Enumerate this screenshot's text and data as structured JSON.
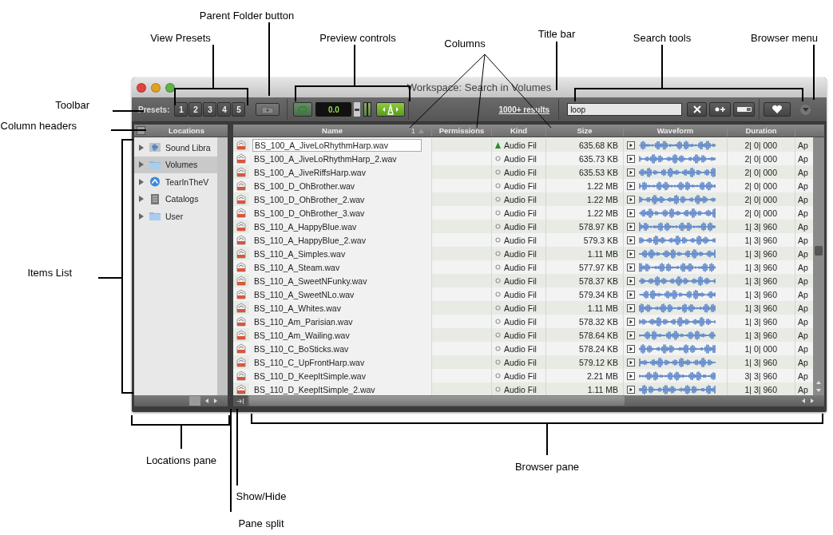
{
  "window": {
    "title": "Workspace: Search in Volumes"
  },
  "toolbar": {
    "presets_label": "Presets:",
    "presets": [
      "1",
      "2",
      "3",
      "4",
      "5"
    ],
    "counter": "0.0",
    "results": "1000+ results",
    "search": {
      "value": "loop"
    }
  },
  "locations": {
    "header": "Locations",
    "items": [
      {
        "label": "Sound Libra",
        "kind": "library",
        "selected": false,
        "expanded": false
      },
      {
        "label": "Volumes",
        "kind": "folder",
        "selected": true,
        "expanded": false
      },
      {
        "label": "TearInTheV",
        "kind": "disk",
        "selected": false,
        "expanded": false
      },
      {
        "label": "Catalogs",
        "kind": "catalog",
        "selected": false,
        "expanded": false
      },
      {
        "label": "User",
        "kind": "folder",
        "selected": false,
        "expanded": false
      }
    ]
  },
  "browser": {
    "columns": [
      {
        "label": "Name",
        "sort_index": "1"
      },
      {
        "label": "Permissions"
      },
      {
        "label": "Kind"
      },
      {
        "label": "Size"
      },
      {
        "label": "Waveform"
      },
      {
        "label": "Duration"
      }
    ],
    "rows": [
      {
        "name": "BS_100_A_JiveLoRhythmHarp.wav",
        "editing": true,
        "kind": "Audio Fil",
        "marked": true,
        "size": "635.68 KB",
        "duration": "2| 0| 000",
        "column_7": "Ap"
      },
      {
        "name": "BS_100_A_JiveLoRhythmHarp_2.wav",
        "editing": false,
        "kind": "Audio Fil",
        "marked": false,
        "size": "635.73 KB",
        "duration": "2| 0| 000",
        "column_7": "Ap"
      },
      {
        "name": "BS_100_A_JiveRiffsHarp.wav",
        "editing": false,
        "kind": "Audio Fil",
        "marked": false,
        "size": "635.53 KB",
        "duration": "2| 0| 000",
        "column_7": "Ap"
      },
      {
        "name": "BS_100_D_OhBrother.wav",
        "editing": false,
        "kind": "Audio Fil",
        "marked": false,
        "size": "1.22 MB",
        "duration": "2| 0| 000",
        "column_7": "Ap"
      },
      {
        "name": "BS_100_D_OhBrother_2.wav",
        "editing": false,
        "kind": "Audio Fil",
        "marked": false,
        "size": "1.22 MB",
        "duration": "2| 0| 000",
        "column_7": "Ap"
      },
      {
        "name": "BS_100_D_OhBrother_3.wav",
        "editing": false,
        "kind": "Audio Fil",
        "marked": false,
        "size": "1.22 MB",
        "duration": "2| 0| 000",
        "column_7": "Ap"
      },
      {
        "name": "BS_110_A_HappyBlue.wav",
        "editing": false,
        "kind": "Audio Fil",
        "marked": false,
        "size": "578.97 KB",
        "duration": "1| 3| 960",
        "column_7": "Ap"
      },
      {
        "name": "BS_110_A_HappyBlue_2.wav",
        "editing": false,
        "kind": "Audio Fil",
        "marked": false,
        "size": "579.3 KB",
        "duration": "1| 3| 960",
        "column_7": "Ap"
      },
      {
        "name": "BS_110_A_Simples.wav",
        "editing": false,
        "kind": "Audio Fil",
        "marked": false,
        "size": "1.11 MB",
        "duration": "1| 3| 960",
        "column_7": "Ap"
      },
      {
        "name": "BS_110_A_Steam.wav",
        "editing": false,
        "kind": "Audio Fil",
        "marked": false,
        "size": "577.97 KB",
        "duration": "1| 3| 960",
        "column_7": "Ap"
      },
      {
        "name": "BS_110_A_SweetNFunky.wav",
        "editing": false,
        "kind": "Audio Fil",
        "marked": false,
        "size": "578.37 KB",
        "duration": "1| 3| 960",
        "column_7": "Ap"
      },
      {
        "name": "BS_110_A_SweetNLo.wav",
        "editing": false,
        "kind": "Audio Fil",
        "marked": false,
        "size": "579.34 KB",
        "duration": "1| 3| 960",
        "column_7": "Ap"
      },
      {
        "name": "BS_110_A_Whites.wav",
        "editing": false,
        "kind": "Audio Fil",
        "marked": false,
        "size": "1.11 MB",
        "duration": "1| 3| 960",
        "column_7": "Ap"
      },
      {
        "name": "BS_110_Am_Parisian.wav",
        "editing": false,
        "kind": "Audio Fil",
        "marked": false,
        "size": "578.32 KB",
        "duration": "1| 3| 960",
        "column_7": "Ap"
      },
      {
        "name": "BS_110_Am_Wailing.wav",
        "editing": false,
        "kind": "Audio Fil",
        "marked": false,
        "size": "578.64 KB",
        "duration": "1| 3| 960",
        "column_7": "Ap"
      },
      {
        "name": "BS_110_C_BoSticks.wav",
        "editing": false,
        "kind": "Audio Fil",
        "marked": false,
        "size": "578.24 KB",
        "duration": "1| 0| 000",
        "column_7": "Ap"
      },
      {
        "name": "BS_110_C_UpFrontHarp.wav",
        "editing": false,
        "kind": "Audio Fil",
        "marked": false,
        "size": "579.12 KB",
        "duration": "1| 3| 960",
        "column_7": "Ap"
      },
      {
        "name": "BS_110_D_KeepItSimple.wav",
        "editing": false,
        "kind": "Audio Fil",
        "marked": false,
        "size": "2.21 MB",
        "duration": "3| 3| 960",
        "column_7": "Ap"
      },
      {
        "name": "BS_110_D_KeepItSimple_2.wav",
        "editing": false,
        "kind": "Audio Fil",
        "marked": false,
        "size": "1.11 MB",
        "duration": "1| 3| 960",
        "column_7": "Ap"
      }
    ]
  },
  "callouts": [
    {
      "label": "Parent Folder button"
    },
    {
      "label": "View Presets"
    },
    {
      "label": "Preview controls"
    },
    {
      "label": "Columns"
    },
    {
      "label": "Title bar"
    },
    {
      "label": "Search tools"
    },
    {
      "label": "Browser menu"
    },
    {
      "label": "Toolbar"
    },
    {
      "label": "Column headers"
    },
    {
      "label": "Items List"
    },
    {
      "label": "Locations pane"
    },
    {
      "label": "Browser pane"
    },
    {
      "label": "Show/Hide"
    },
    {
      "label": "Pane split"
    }
  ]
}
